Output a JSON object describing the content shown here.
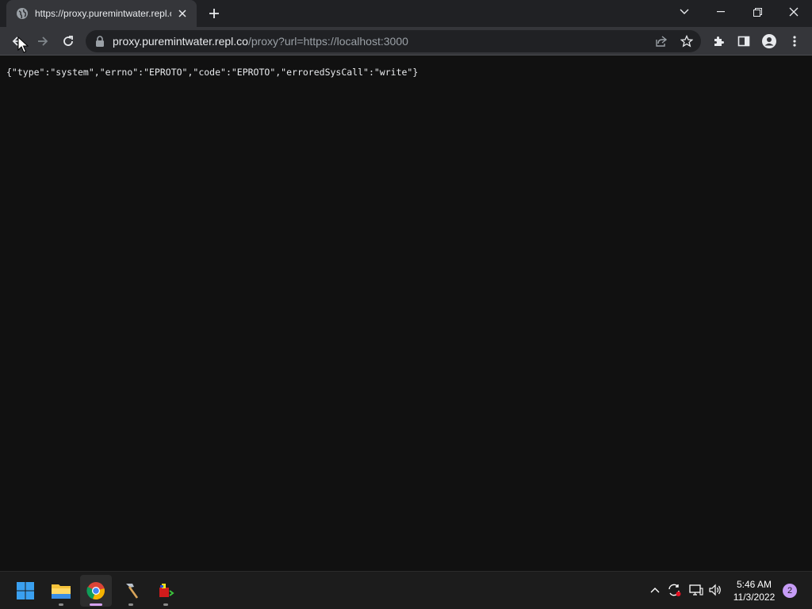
{
  "browser": {
    "tab": {
      "title": "https://proxy.puremintwater.repl.co/proxy?url=https://localhost:3000",
      "favicon": "globe-icon"
    },
    "address": {
      "host": "proxy.puremintwater.repl.co",
      "path": "/proxy?url=https://localhost:3000"
    }
  },
  "page": {
    "body_text": "{\"type\":\"system\",\"errno\":\"EPROTO\",\"code\":\"EPROTO\",\"erroredSysCall\":\"write\"}"
  },
  "taskbar": {
    "apps": [
      "start-icon",
      "file-explorer-icon",
      "chrome-icon",
      "hammer-icon",
      "app-icon"
    ],
    "clock": {
      "time": "5:46 AM",
      "date": "11/3/2022"
    },
    "notification_count": "2"
  },
  "colors": {
    "page_bg": "#111111",
    "tabstrip_bg": "#202124",
    "toolbar_bg": "#35363a",
    "accent": "#c69cf6"
  }
}
